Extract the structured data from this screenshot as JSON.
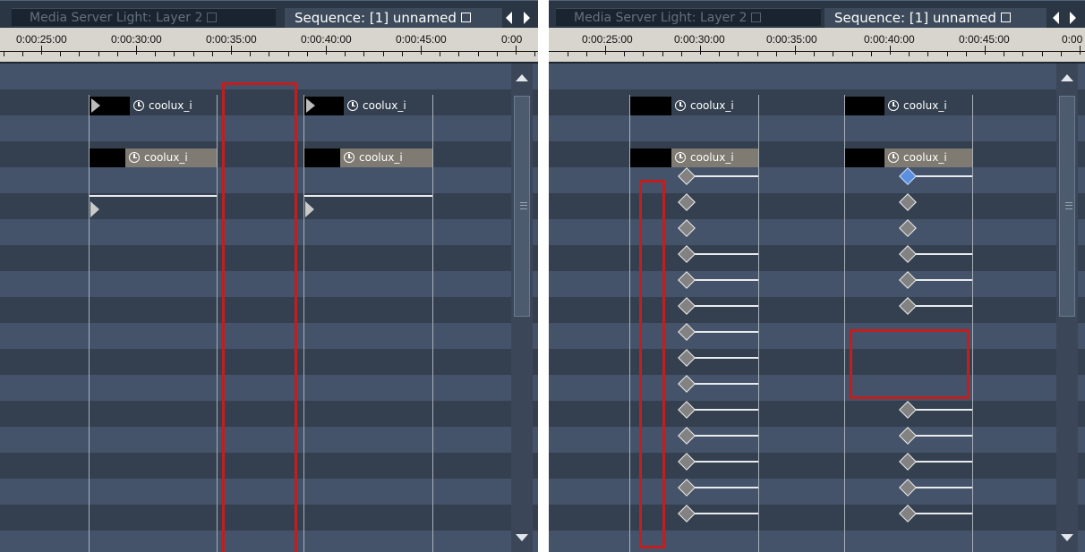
{
  "tabs": {
    "inactive_label": "Media Server Light: Layer 2",
    "active_label": "Sequence: [1] unnamed"
  },
  "ruler_labels": [
    "0:00:25:00",
    "0:00:30:00",
    "0:00:35:00",
    "0:00:40:00",
    "0:00:45:00",
    "0:00"
  ],
  "clip_label": "coolux_i",
  "colors": {
    "highlight_red": "#c11f1f",
    "selected_keyframe": "#5b8fe0",
    "keyframe": "#828282"
  }
}
